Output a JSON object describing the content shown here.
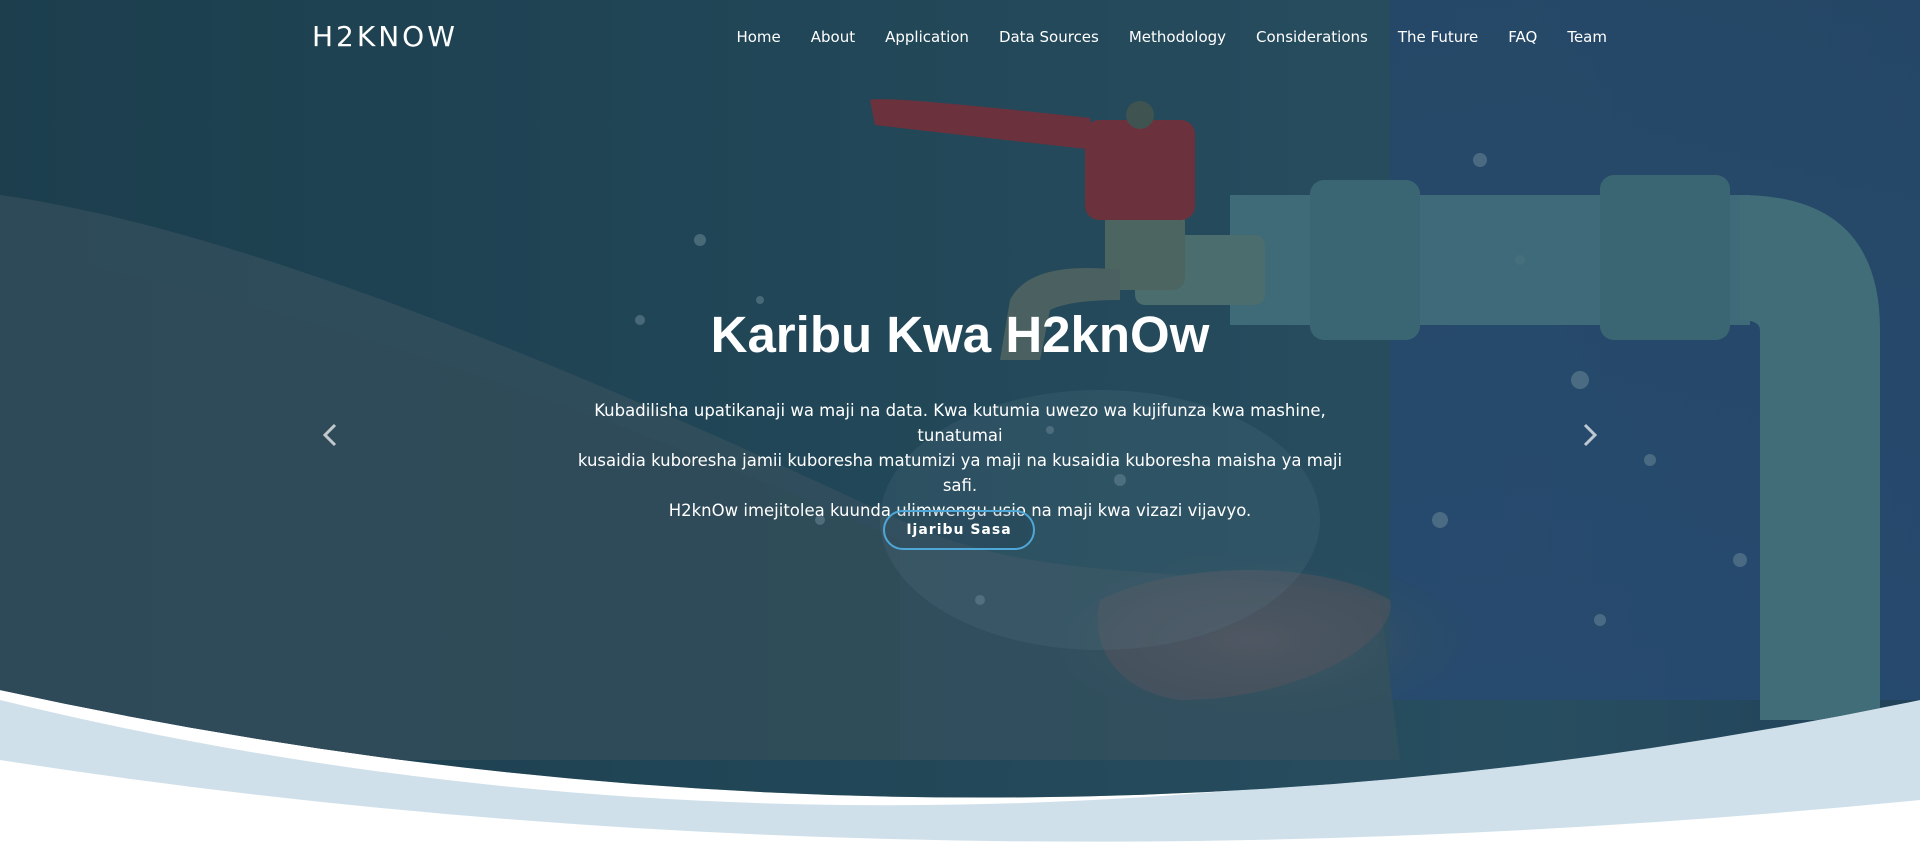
{
  "brand": {
    "name": "H2KNOW"
  },
  "nav": {
    "items": [
      {
        "label": "Home"
      },
      {
        "label": "About"
      },
      {
        "label": "Application"
      },
      {
        "label": "Data Sources"
      },
      {
        "label": "Methodology"
      },
      {
        "label": "Considerations"
      },
      {
        "label": "The Future"
      },
      {
        "label": "FAQ"
      },
      {
        "label": "Team"
      }
    ]
  },
  "hero": {
    "title": "Karibu Kwa H2knOw",
    "lead_lines": [
      "Kubadilisha upatikanaji wa maji na data. Kwa kutumia uwezo wa kujifunza kwa mashine, tunatumai",
      "kusaidia kuboresha jamii kuboresha matumizi ya maji na kusaidia kuboresha maisha ya maji safi.",
      "H2knOw imejitolea kuunda ulimwengu usio na maji kwa vizazi vijavyo."
    ],
    "cta_label": "Ijaribu Sasa",
    "prev_icon": "chevron-left-icon",
    "next_icon": "chevron-right-icon"
  },
  "colors": {
    "overlay": "#1f4656",
    "cta_border": "#4fa7d8",
    "wave_light": "#cfe0ea",
    "pipe": "#5f8f98",
    "tap_red": "#a3232b"
  }
}
